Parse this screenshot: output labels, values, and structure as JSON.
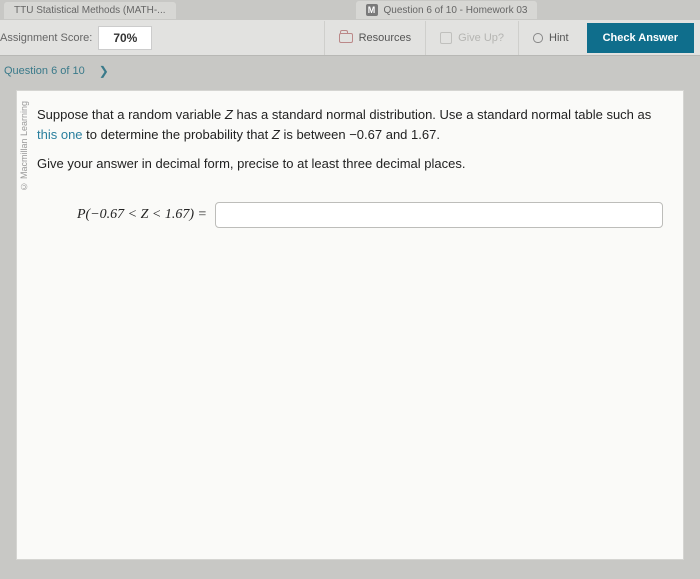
{
  "tabs": {
    "left": "TTU Statistical Methods (MATH-...",
    "right": "Question 6 of 10 - Homework 03",
    "right_icon": "M"
  },
  "toolbar": {
    "score_label": "Assignment Score:",
    "score_value": "70%",
    "resources": "Resources",
    "give_up": "Give Up?",
    "hint": "Hint",
    "check_answer": "Check Answer"
  },
  "nav": {
    "label": "Question 6 of 10"
  },
  "copyright": "© Macmillan Learning",
  "question": {
    "p1a": "Suppose that a random variable ",
    "zvar": "Z",
    "p1b": " has a standard normal distribution. Use a standard normal table such as ",
    "link": "this one",
    "p1c": " to determine the probability that ",
    "p1d": " is between −0.67 and 1.67.",
    "p2": "Give your answer in decimal form, precise to at least three decimal places.",
    "answer_label": "P(−0.67 < Z < 1.67) =",
    "answer_value": ""
  }
}
